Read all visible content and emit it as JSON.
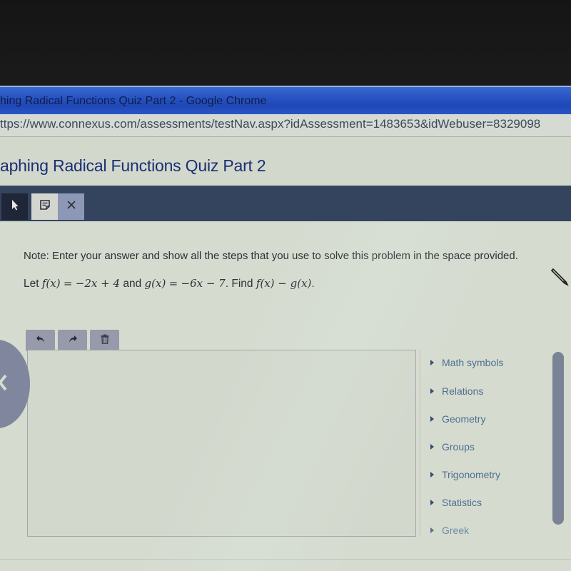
{
  "browser": {
    "window_title": "hing Radical Functions Quiz Part 2 - Google Chrome",
    "url": "ttps://www.connexus.com/assessments/testNav.aspx?idAssessment=1483653&idWebuser=8329098"
  },
  "page": {
    "title": "aphing Radical Functions Quiz Part 2"
  },
  "toolbar": {
    "buttons": [
      {
        "name": "pointer",
        "icon": "cursor-arrow-icon"
      },
      {
        "name": "notes",
        "icon": "note-icon"
      },
      {
        "name": "close",
        "icon": "close-icon"
      }
    ]
  },
  "question": {
    "note": "Note: Enter your answer and show all the steps that you use to solve this problem in the space provided.",
    "let": "Let",
    "f_lhs": "f(x)",
    "eq1": "=",
    "f_rhs": "−2x + 4",
    "and": "and",
    "g_lhs": "g(x)",
    "eq2": "=",
    "g_rhs": "−6x − 7",
    "find": ". Find",
    "expr": "f(x) − g(x)",
    "end": "."
  },
  "editor": {
    "buttons": [
      {
        "name": "undo",
        "icon": "undo-icon"
      },
      {
        "name": "redo",
        "icon": "redo-icon"
      },
      {
        "name": "delete",
        "icon": "trash-icon"
      }
    ],
    "answer_value": ""
  },
  "symbol_panel": {
    "items": [
      {
        "label": "Math symbols"
      },
      {
        "label": "Relations"
      },
      {
        "label": "Geometry"
      },
      {
        "label": "Groups"
      },
      {
        "label": "Trigonometry"
      },
      {
        "label": "Statistics"
      },
      {
        "label": "Greek"
      }
    ]
  },
  "colors": {
    "title_bar": "#2a55c4",
    "page_title": "#1b2e72",
    "toolbar": "#34445f",
    "panel_link": "#4d6f8f"
  }
}
